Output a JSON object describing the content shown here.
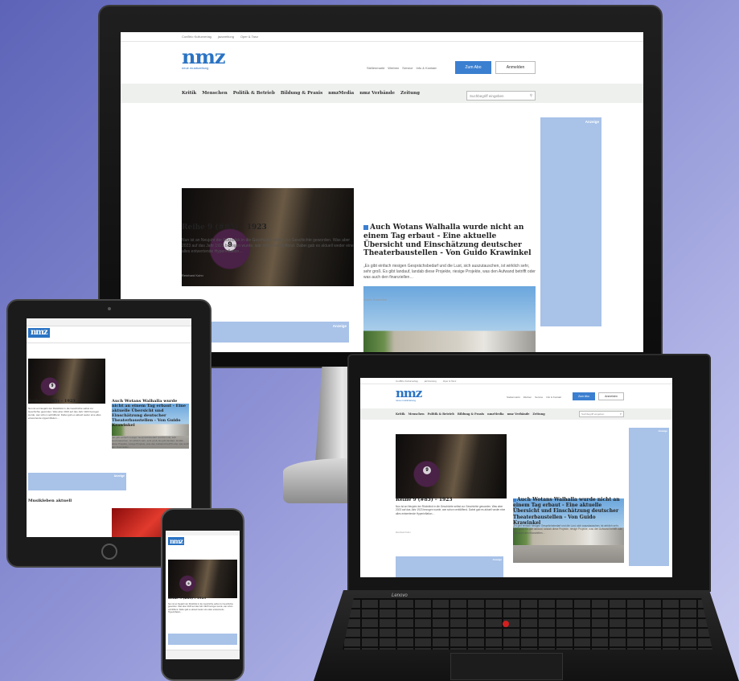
{
  "site": {
    "topbar": [
      "ConBrio Kulturverlag",
      "jazzzeitung",
      "Oper & Tanz"
    ],
    "logo": "nmz",
    "logo_sub": "neue musikzeitung",
    "header_links": [
      "Stellenmarkt",
      "Werben",
      "Service",
      "Info & Kontakt"
    ],
    "btn_subscribe": "Zum Abo",
    "btn_login": "Anmelden",
    "nav": [
      "Kritik",
      "Menschen",
      "Politik & Betrieb",
      "Bildung & Praxis",
      "nmzMedia",
      "nmz Verbände",
      "Zeitung"
    ],
    "search_placeholder": "Suchbegriff eingeben",
    "ad_label": "Anzeige",
    "badge_number": "9",
    "section_title": "Musikleben aktuell"
  },
  "articles": [
    {
      "title": "Reihe 9 (#85) – 1923",
      "text": "Nun ist an Neujahr der Rückblick in die Geschichte selbst zur Geschichte geworden. Was aber 2023 auf das Jahr 1923 bezogen wurde, war schon verblüffend. Dabei gab es aktuell weder eine alles entwertende Hyperinflation…",
      "author": "Reinhard Kuhn"
    },
    {
      "title": "Auch Wotans Walhalla wurde nicht an einem Tag erbaut - Eine aktuelle Übersicht und Einschätzung deutscher Theaterbaustellen - Von Guido Krawinkel",
      "text": "„Es gibt einfach riesigen Gesprächsbedarf und die Lust, sich auszutauschen, ist wirklich sehr, sehr groß. Es gibt landauf, landab diese Projekte, riesige Projekte, was den Aufwand betrifft oder was auch den finanziellen…",
      "author": "Guido Krawinkel"
    }
  ],
  "laptop": {
    "brand": "Lenovo"
  }
}
